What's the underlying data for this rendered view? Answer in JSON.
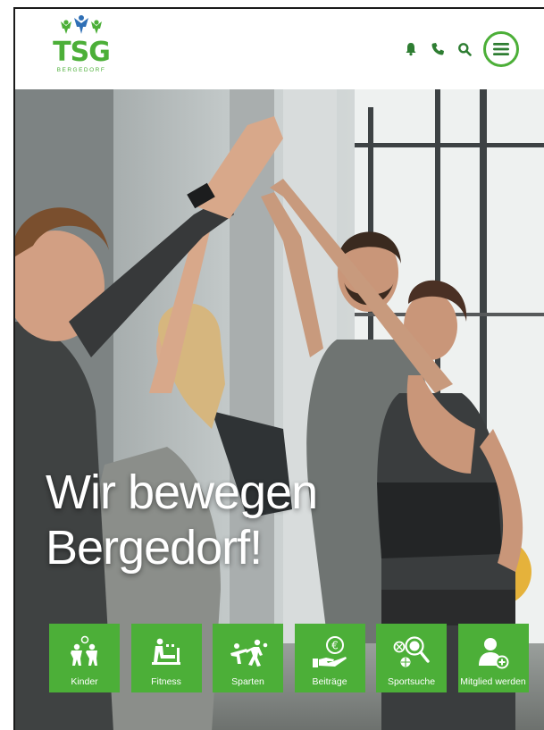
{
  "brand": {
    "name": "TSG",
    "subtitle": "BERGEDORF",
    "color": "#4caf38"
  },
  "header": {
    "icons": [
      "bell-icon",
      "phone-icon",
      "search-icon",
      "menu-icon"
    ]
  },
  "hero": {
    "headline_line1": "Wir bewegen",
    "headline_line2": "Bergedorf!"
  },
  "tiles": [
    {
      "label": "Kinder",
      "icon": "children-icon"
    },
    {
      "label": "Fitness",
      "icon": "fitness-icon"
    },
    {
      "label": "Sparten",
      "icon": "sports-icon"
    },
    {
      "label": "Beiträge",
      "icon": "euro-hand-icon"
    },
    {
      "label": "Sportsuche",
      "icon": "ball-search-icon"
    },
    {
      "label": "Mitglied werden",
      "icon": "add-member-icon"
    }
  ]
}
